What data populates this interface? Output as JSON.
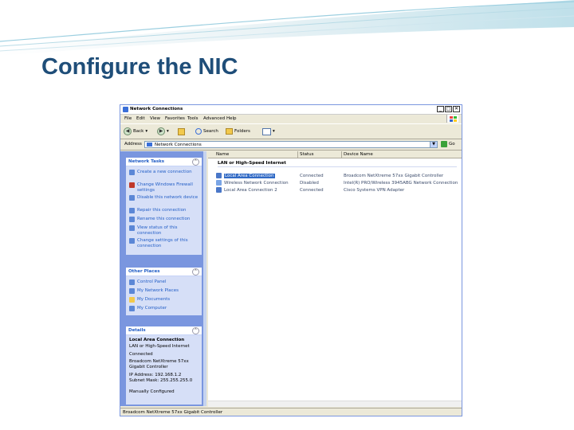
{
  "slide": {
    "title": "Configure the NIC"
  },
  "window": {
    "title": "Network Connections",
    "controls": [
      "_",
      "□",
      "✕"
    ],
    "menu": [
      "File",
      "Edit",
      "View",
      "Favorites",
      "Tools",
      "Advanced",
      "Help"
    ],
    "toolbar": {
      "back": "Back",
      "search": "Search",
      "folders": "Folders"
    },
    "address": {
      "label": "Address",
      "value": "Network Connections",
      "go": "Go"
    },
    "network_tasks": {
      "title": "Network Tasks",
      "items": [
        "Create a new connection",
        "Change Windows Firewall settings",
        "Disable this network device",
        "Repair this connection",
        "Rename this connection",
        "View status of this connection",
        "Change settings of this connection"
      ]
    },
    "other_places": {
      "title": "Other Places",
      "items": [
        "Control Panel",
        "My Network Places",
        "My Documents",
        "My Computer"
      ]
    },
    "details": {
      "title": "Details",
      "lines": [
        "Local Area Connection",
        "LAN or High-Speed Internet",
        "Connected",
        "Broadcom NetXtreme 57xx Gigabit Controller",
        "IP Address: 192.168.1.2",
        "Subnet Mask: 255.255.255.0",
        "Manually Configured"
      ]
    },
    "columns": [
      "Name",
      "Status",
      "Device Name"
    ],
    "group": "LAN or High-Speed Internet",
    "connections": [
      {
        "name": "Local Area Connection",
        "status": "Connected",
        "device": "Broadcom NetXtreme 57xx Gigabit Controller"
      },
      {
        "name": "Wireless Network Connection",
        "status": "Disabled",
        "device": "Intel(R) PRO/Wireless 3945ABG Network Connection"
      },
      {
        "name": "Local Area Connection 2",
        "status": "Connected",
        "device": "Cisco Systems VPN Adapter"
      }
    ],
    "status_bar": "Broadcom NetXtreme 57xx Gigabit Controller"
  },
  "colors": {
    "title": "#1f4e79",
    "accent": "#3aa0c0",
    "selection": "#316ac5",
    "panel": "#7a96df"
  }
}
